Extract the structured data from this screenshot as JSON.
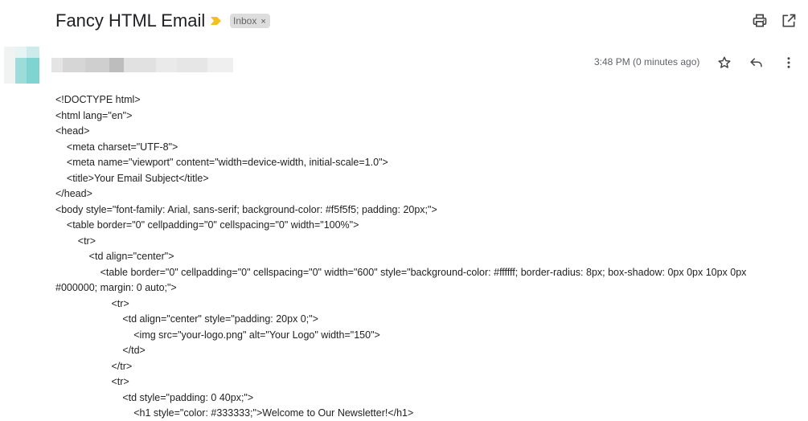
{
  "email": {
    "subject": "Fancy HTML Email",
    "label": "Inbox",
    "label_remove": "×",
    "timestamp": "3:48 PM (0 minutes ago)"
  },
  "icons": {
    "importance": "importance-marker-icon",
    "print": "print-icon",
    "open_new_window": "open-in-new-window-icon",
    "star": "star-icon",
    "reply": "reply-icon",
    "more": "more-vertical-icon"
  },
  "colors": {
    "importance": "#f2c01f",
    "avatar_teal": "#7fd3d0",
    "label_bg": "#dddddd"
  },
  "body_lines": [
    "<!DOCTYPE html>",
    "<html lang=\"en\">",
    "<head>",
    "    <meta charset=\"UTF-8\">",
    "    <meta name=\"viewport\" content=\"width=device-width, initial-scale=1.0\">",
    "    <title>Your Email Subject</title>",
    "</head>",
    "<body style=\"font-family: Arial, sans-serif; background-color: #f5f5f5; padding: 20px;\">",
    "    <table border=\"0\" cellpadding=\"0\" cellspacing=\"0\" width=\"100%\">",
    "        <tr>",
    "            <td align=\"center\">",
    "                <table border=\"0\" cellpadding=\"0\" cellspacing=\"0\" width=\"600\" style=\"background-color: #ffffff; border-radius: 8px; box-shadow: 0px 0px 10px 0px",
    "#000000; margin: 0 auto;\">",
    "                    <tr>",
    "                        <td align=\"center\" style=\"padding: 20px 0;\">",
    "                            <img src=\"your-logo.png\" alt=\"Your Logo\" width=\"150\">",
    "                        </td>",
    "                    </tr>",
    "                    <tr>",
    "                        <td style=\"padding: 0 40px;\">",
    "                            <h1 style=\"color: #333333;\">Welcome to Our Newsletter!</h1>"
  ]
}
